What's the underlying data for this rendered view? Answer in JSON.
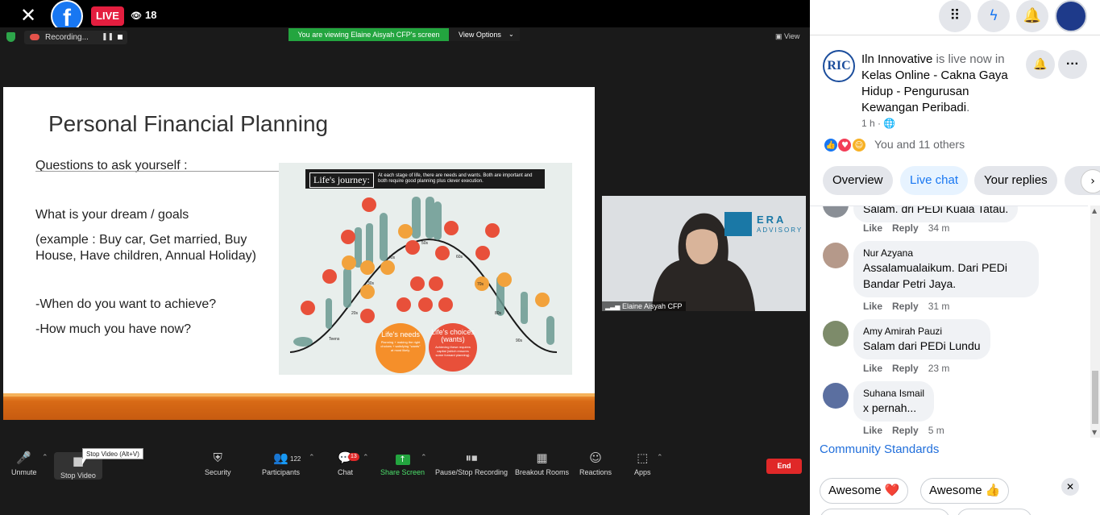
{
  "live": {
    "badge": "LIVE",
    "viewers": "18"
  },
  "zoom": {
    "recording_label": "Recording...",
    "viewing_banner": "You are viewing Elaine Aisyah CFP's screen",
    "view_options": "View Options",
    "view_label": "View",
    "speaker_name": "Elaine Aisyah CFP",
    "tooltip": "Stop Video (Alt+V)",
    "participants_count": "122",
    "chat_badge": "13",
    "end_label": "End",
    "toolbar": [
      {
        "name": "unmute",
        "label": "Unmute",
        "icon": "mic-muted-icon"
      },
      {
        "name": "stop-video",
        "label": "Stop Video",
        "icon": "video-icon"
      },
      {
        "name": "security",
        "label": "Security",
        "icon": "shield-icon"
      },
      {
        "name": "participants",
        "label": "Participants",
        "icon": "people-icon"
      },
      {
        "name": "chat",
        "label": "Chat",
        "icon": "chat-icon"
      },
      {
        "name": "share-screen",
        "label": "Share Screen",
        "icon": "share-icon"
      },
      {
        "name": "pause-stop-recording",
        "label": "Pause/Stop Recording",
        "icon": "pause-stop-icon"
      },
      {
        "name": "breakout-rooms",
        "label": "Breakout Rooms",
        "icon": "grid-icon"
      },
      {
        "name": "reactions",
        "label": "Reactions",
        "icon": "smile-icon"
      },
      {
        "name": "apps",
        "label": "Apps",
        "icon": "apps-icon"
      }
    ]
  },
  "slide": {
    "title": "Personal Financial Planning",
    "q1": "Questions to ask yourself :",
    "q2": "What is your dream  / goals",
    "q3": "(example : Buy car, Get married, Buy House, Have children, Annual Holiday)",
    "q4": "-When do you want to achieve?",
    "q5": "-How much you have now?",
    "journey_title": "Life's journey:",
    "journey_sub": "At each stage of life, there are needs and wants. Both are important and both require good planning plus clever execution.",
    "needs_title": "Life's needs",
    "needs_sub": "Planning + making the right choices + satisfying \"wants\" at most likely.",
    "wants_title": "Life's choices (wants)",
    "wants_sub": "Achieving these requires capital (which ensures some forward planning).",
    "ages": [
      "Teens",
      "20s",
      "30s",
      "40s",
      "50s",
      "60s",
      "70s",
      "80s",
      "90s"
    ]
  },
  "logo": {
    "line1": "ERA",
    "line2": "ADVISORY"
  },
  "post": {
    "page_name": "Iln Innovative",
    "is_live": " is live now in ",
    "event": "Kelas Online - Cakna Gaya Hidup - Pengurusan Kewangan Peribadi",
    "period": ".",
    "time": "1 h ·",
    "reactions_text": "You and 11 others"
  },
  "tabs": [
    "Overview",
    "Live chat",
    "Your replies"
  ],
  "comments": [
    {
      "name": "",
      "text": "Salam. dri PEDi Kuala Tatau.",
      "time": "34 m"
    },
    {
      "name": "Nur Azyana",
      "text": "Assalamualaikum. Dari PEDi Bandar Petri Jaya.",
      "time": "31 m"
    },
    {
      "name": "Amy Amirah Pauzi",
      "text": "Salam dari PEDi Lundu",
      "time": "23 m"
    },
    {
      "name": "Suhana Ismail",
      "text": "x pernah...",
      "time": "5 m"
    }
  ],
  "comment_actions": {
    "like": "Like",
    "reply": "Reply"
  },
  "community": "Community Standards",
  "suggestions": [
    "Awesome ❤️",
    "Awesome 👍"
  ],
  "colors": {
    "fb_blue": "#1877f2",
    "live_red": "#e41e3f",
    "zoom_green": "#23a53f"
  }
}
